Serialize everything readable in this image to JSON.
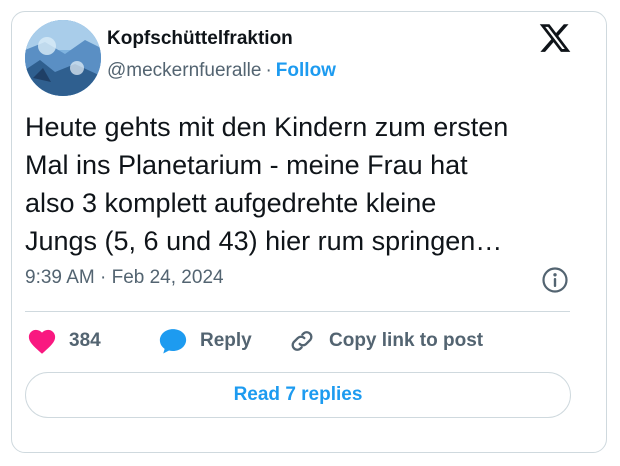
{
  "tweet": {
    "author_name": "Kopfschüttelfraktion",
    "handle": "@meckernfueralle",
    "separator": "·",
    "follow_label": "Follow",
    "text": "Heute gehts mit den Kindern zum ersten\nMal ins Planetarium - meine Frau hat\nalso 3 komplett aufgedrehte kleine\nJungs (5, 6 und 43) hier rum springen…",
    "timestamp": "9:39 AM · Feb 24, 2024"
  },
  "actions": {
    "like_count": "384",
    "reply_label": "Reply",
    "copy_link_label": "Copy link to post"
  },
  "read_replies_label": "Read 7 replies",
  "icons": {
    "brand": "x-logo-icon",
    "info": "info-icon",
    "like": "heart-icon",
    "reply": "speech-bubble-icon",
    "copy": "link-icon"
  },
  "colors": {
    "accent": "#1d9bf0",
    "like": "#f91880",
    "secondary_text": "#536471",
    "border": "#cfd9de"
  }
}
